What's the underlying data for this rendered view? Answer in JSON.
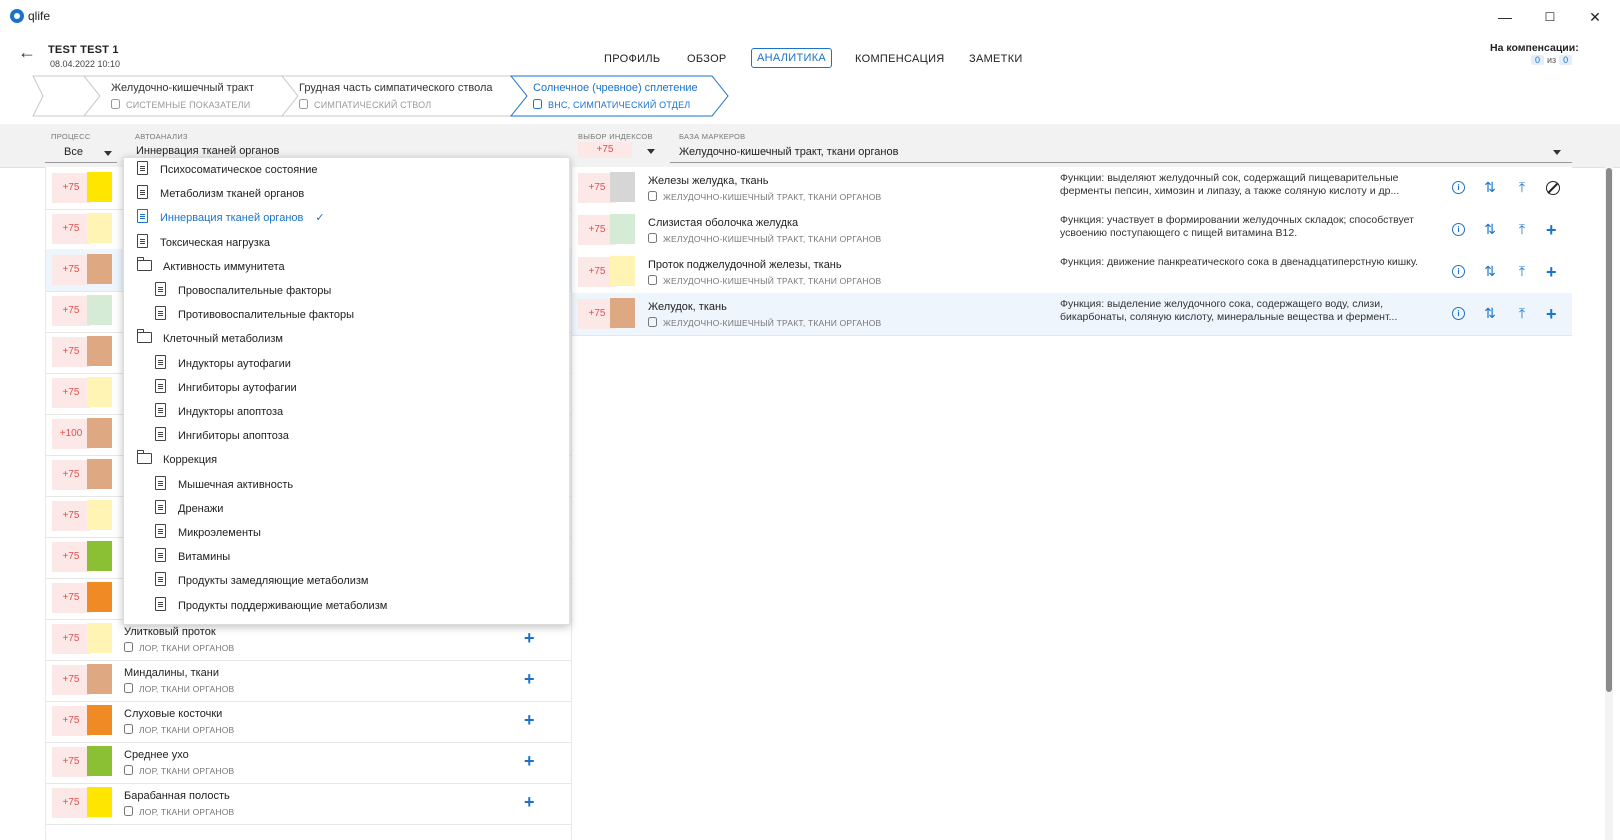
{
  "app": {
    "title": "qlife"
  },
  "window": {
    "minimize": "—",
    "maximize": "☐",
    "close": "✕"
  },
  "header": {
    "back": "←",
    "patient_name": "TEST TEST 1",
    "patient_date": "08.04.2022 10:10",
    "tabs": [
      "ПРОФИЛЬ",
      "ОБЗОР",
      "АНАЛИТИКА",
      "КОМПЕНСАЦИЯ",
      "ЗАМЕТКИ"
    ],
    "active_tab": "АНАЛИТИКА",
    "compensation_label": "На компенсации:",
    "comp_current": "0",
    "comp_of": "из",
    "comp_total": "0"
  },
  "breadcrumbs": [
    {
      "title": "Желудочно-кишечный тракт",
      "sub": "СИСТЕМНЫЕ ПОКАЗАТЕЛИ"
    },
    {
      "title": "Грудная часть симпатического ствола",
      "sub": "СИМПАТИЧЕСКИЙ СТВОЛ"
    },
    {
      "title": "Солнечное (чревное) сплетение",
      "sub": "ВНС, СИМПАТИЧЕСКИЙ ОТДЕЛ"
    }
  ],
  "filters": {
    "process_label": "ПРОЦЕСС",
    "process_value": "Все",
    "autoanalysis_label": "АВТОАНАЛИЗ",
    "autoanalysis_value": "Иннервация тканей органов",
    "index_label": "ВЫБОР ИНДЕКСОВ",
    "index_value": "+75",
    "markers_label": "БАЗА МАРКЕРОВ",
    "markers_value": "Желудочно-кишечный тракт, ткани органов"
  },
  "dropdown": {
    "items": [
      {
        "label": "Психосоматическое состояние",
        "type": "doc",
        "level": 0
      },
      {
        "label": "Метаболизм тканей органов",
        "type": "doc",
        "level": 0
      },
      {
        "label": "Иннервация тканей органов",
        "type": "doc",
        "level": 0,
        "selected": true
      },
      {
        "label": "Токсическая нагрузка",
        "type": "doc",
        "level": 0
      },
      {
        "label": "Активность иммунитета",
        "type": "folder",
        "level": 0
      },
      {
        "label": "Провоспалительные факторы",
        "type": "doc",
        "level": 1
      },
      {
        "label": "Противовоспалительные факторы",
        "type": "doc",
        "level": 1
      },
      {
        "label": "Клеточный метаболизм",
        "type": "folder",
        "level": 0
      },
      {
        "label": "Индукторы аутофагии",
        "type": "doc",
        "level": 1
      },
      {
        "label": "Ингибиторы аутофагии",
        "type": "doc",
        "level": 1
      },
      {
        "label": "Индукторы апоптоза",
        "type": "doc",
        "level": 1
      },
      {
        "label": "Ингибиторы апоптоза",
        "type": "doc",
        "level": 1
      },
      {
        "label": "Коррекция",
        "type": "folder",
        "level": 0
      },
      {
        "label": "Мышечная активность",
        "type": "doc",
        "level": 1
      },
      {
        "label": "Дренажи",
        "type": "doc",
        "level": 1
      },
      {
        "label": "Микроэлементы",
        "type": "doc",
        "level": 1
      },
      {
        "label": "Витамины",
        "type": "doc",
        "level": 1
      },
      {
        "label": "Продукты замедляющие метаболизм",
        "type": "doc",
        "level": 1
      },
      {
        "label": "Продукты поддерживающие метаболизм",
        "type": "doc",
        "level": 1
      }
    ]
  },
  "left_list": [
    {
      "score": "+75",
      "color": "#FFE600"
    },
    {
      "score": "+75",
      "color": "#FFF4B3"
    },
    {
      "score": "+75",
      "color": "#DDA882",
      "selected": true
    },
    {
      "score": "+75",
      "color": "#D6EBD6"
    },
    {
      "score": "+75",
      "color": "#DDA882"
    },
    {
      "score": "+75",
      "color": "#FFF4B3"
    },
    {
      "score": "+100",
      "color": "#DDA882"
    },
    {
      "score": "+75",
      "color": "#DDA882"
    },
    {
      "score": "+75",
      "color": "#FFF4B3"
    },
    {
      "score": "+75",
      "color": "#8BC034"
    },
    {
      "score": "+75",
      "color": "#F08A24"
    },
    {
      "score": "+75",
      "color": "#FFF4B3",
      "name": "Улитковый проток",
      "category": "ЛОР, ТКАНИ ОРГАНОВ"
    },
    {
      "score": "+75",
      "color": "#DDA882",
      "name": "Миндалины, ткани",
      "category": "ЛОР, ТКАНИ ОРГАНОВ"
    },
    {
      "score": "+75",
      "color": "#F08A24",
      "name": "Слуховые косточки",
      "category": "ЛОР, ТКАНИ ОРГАНОВ"
    },
    {
      "score": "+75",
      "color": "#8BC034",
      "name": "Среднее ухо",
      "category": "ЛОР, ТКАНИ ОРГАНОВ"
    },
    {
      "score": "+75",
      "color": "#FFE600",
      "name": "Барабанная полость",
      "category": "ЛОР, ТКАНИ ОРГАНОВ"
    }
  ],
  "right_rows": [
    {
      "score": "+75",
      "color": "#D6D6D6",
      "name": "Железы желудка, ткань",
      "category": "ЖЕЛУДОЧНО-КИШЕЧНЫЙ ТРАКТ, ТКАНИ ОРГАНОВ",
      "desc": "Функции: выделяют желудочный сок, содержащий пищеварительные ферменты пепсин, химозин и липазу, а также соляную кислоту и др...",
      "last_icon": "block"
    },
    {
      "score": "+75",
      "color": "#D6EBD6",
      "name": "Слизистая оболочка желудка",
      "category": "ЖЕЛУДОЧНО-КИШЕЧНЫЙ ТРАКТ, ТКАНИ ОРГАНОВ",
      "desc": "Функция: участвует в формировании желудочных складок; способствует усвоению поступающего с пищей витамина B12.",
      "last_icon": "plus"
    },
    {
      "score": "+75",
      "color": "#FFF4B3",
      "name": "Проток поджелудочной железы, ткань",
      "category": "ЖЕЛУДОЧНО-КИШЕЧНЫЙ ТРАКТ, ТКАНИ ОРГАНОВ",
      "desc": "Функция: движение панкреатического сока в двенадцатиперстную кишку.",
      "last_icon": "plus"
    },
    {
      "score": "+75",
      "color": "#DDA882",
      "name": "Желудок, ткань",
      "category": "ЖЕЛУДОЧНО-КИШЕЧНЫЙ ТРАКТ, ТКАНИ ОРГАНОВ",
      "desc": "Функция: выделение желудочного сока, содержащего воду, слизи, бикарбонаты, соляную кислоту, минеральные вещества и фермент...",
      "last_icon": "plus",
      "selected": true
    }
  ],
  "icons": {
    "info": "i",
    "sort": "⇅",
    "upload": "⤒",
    "plus": "+"
  }
}
